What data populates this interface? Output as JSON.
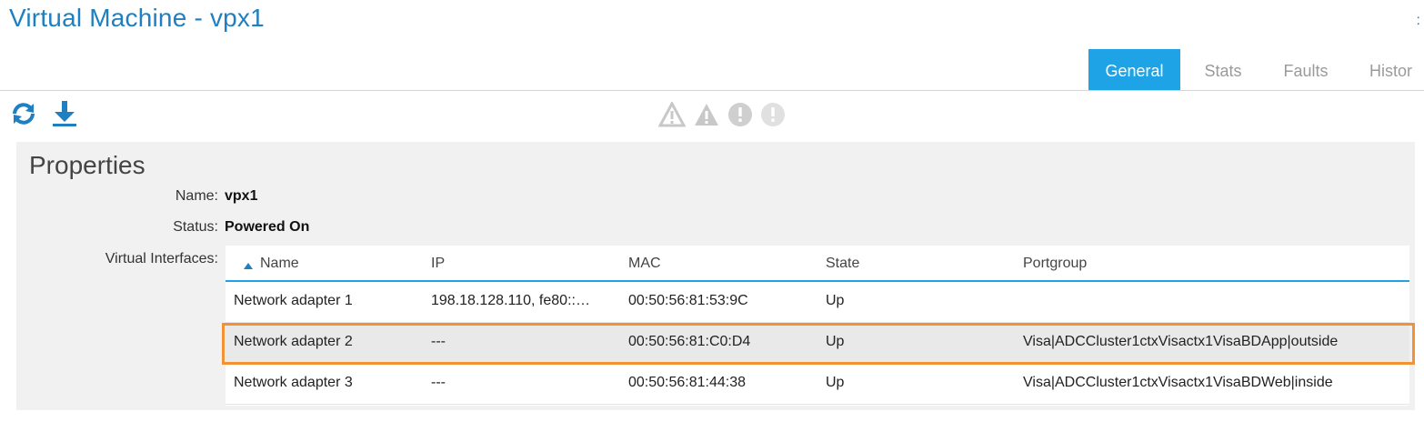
{
  "header": {
    "title": "Virtual Machine - vpx1",
    "corner_link": ":"
  },
  "tabs": [
    {
      "label": "General",
      "active": true
    },
    {
      "label": "Stats",
      "active": false
    },
    {
      "label": "Faults",
      "active": false
    },
    {
      "label": "Histor",
      "active": false
    }
  ],
  "toolbar": {
    "refresh_icon": "refresh-icon",
    "download_icon": "download-icon"
  },
  "alerts": {
    "icons": [
      "warning-outline-icon",
      "warning-filled-icon",
      "exclamation-circle-icon",
      "exclamation-circle-light-icon"
    ]
  },
  "properties": {
    "title": "Properties",
    "name_label": "Name:",
    "name_value": "vpx1",
    "status_label": "Status:",
    "status_value": "Powered On",
    "vif_label": "Virtual Interfaces:"
  },
  "interfaces_table": {
    "sort_icon": "sort-ascending-icon",
    "columns": [
      "Name",
      "IP",
      "MAC",
      "State",
      "Portgroup"
    ],
    "rows": [
      {
        "name": "Network adapter 1",
        "ip": "198.18.128.110, fe80::…",
        "mac": "00:50:56:81:53:9C",
        "state": "Up",
        "portgroup": ""
      },
      {
        "name": "Network adapter 2",
        "ip": "---",
        "mac": "00:50:56:81:C0:D4",
        "state": "Up",
        "portgroup": "Visa|ADCCluster1ctxVisactx1VisaBDApp|outside"
      },
      {
        "name": "Network adapter 3",
        "ip": "---",
        "mac": "00:50:56:81:44:38",
        "state": "Up",
        "portgroup": "Visa|ADCCluster1ctxVisactx1VisaBDWeb|inside"
      }
    ],
    "selected_row": 2
  },
  "colors": {
    "accent": "#1da3e6",
    "title": "#1f7fc1",
    "highlight": "#f39135"
  }
}
